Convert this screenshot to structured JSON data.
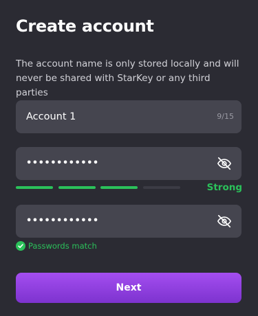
{
  "title": "Create account",
  "description": "The account name is only stored locally and will never be shared with StarKey or any third parties",
  "account_field": {
    "value": "Account 1",
    "counter": "9/15"
  },
  "password_field": {
    "value": "••••••••••••",
    "icon": "eye-off-icon"
  },
  "strength": {
    "label": "Strong",
    "segments_filled": 3,
    "segments_total": 4,
    "color": "#2bc15a"
  },
  "confirm_field": {
    "value": "••••••••••••",
    "icon": "eye-off-icon"
  },
  "match": {
    "text": "Passwords match",
    "icon": "check-circle-icon"
  },
  "next_button": {
    "label": "Next"
  },
  "colors": {
    "background": "#2b2b33",
    "field": "#45454f",
    "accent_purple": "#9140e3",
    "success_green": "#2bc15a"
  }
}
